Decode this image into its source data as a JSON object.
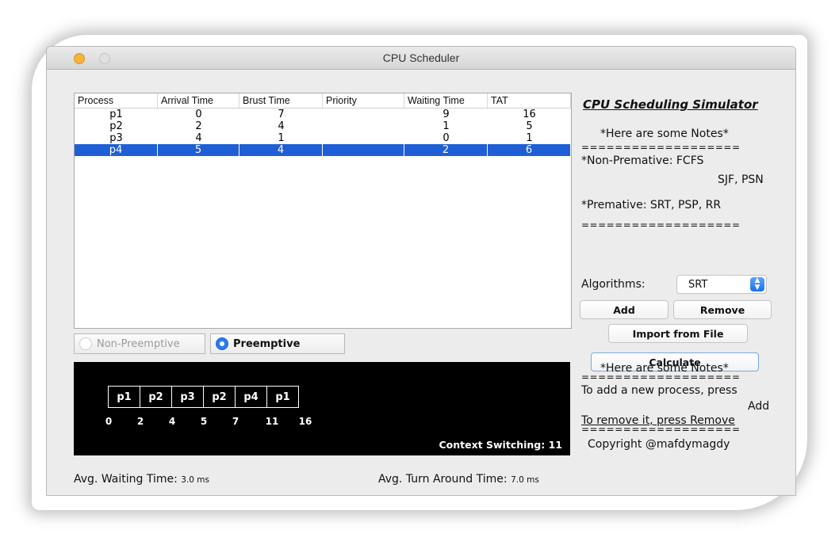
{
  "window": {
    "title": "CPU Scheduler"
  },
  "table": {
    "headers": [
      "Process",
      "Arrival Time",
      "Brust Time",
      "Priority",
      "Waiting Time",
      "TAT"
    ],
    "rows": [
      [
        "p1",
        "0",
        "7",
        "",
        "9",
        "16"
      ],
      [
        "p2",
        "2",
        "4",
        "",
        "1",
        "5"
      ],
      [
        "p3",
        "4",
        "1",
        "",
        "0",
        "1"
      ],
      [
        "p4",
        "5",
        "4",
        "",
        "2",
        "6"
      ]
    ],
    "selected_row": 3
  },
  "mode": {
    "non_preemptive_label": "Non-Preemptive",
    "preemptive_label": "Preemptive",
    "selected": "Preemptive"
  },
  "gantt": {
    "blocks": [
      "p1",
      "p2",
      "p3",
      "p2",
      "p4",
      "p1"
    ],
    "times": [
      "0",
      "2",
      "4",
      "5",
      "7",
      "11",
      "16"
    ],
    "context_switching": "Context Switching: 11"
  },
  "footer": {
    "avg_waiting_label": "Avg. Waiting Time:",
    "avg_waiting_value": "3.0 ms",
    "avg_tat_label": "Avg. Turn Around Time:",
    "avg_tat_value": "7.0 ms"
  },
  "panel": {
    "title": "CPU Scheduling Simulator",
    "notes_heading": "*Here are some Notes*",
    "separator": "===================",
    "non_premative_line1": "*Non-Premative: FCFS",
    "non_premative_line2": "SJF, PSN",
    "premative_line": "*Premative: SRT, PSP, RR",
    "algorithms_label": "Algorithms:",
    "algorithm_selected": "SRT",
    "add_label": "Add",
    "remove_label": "Remove",
    "import_label": "Import from File",
    "calculate_label": "Calculate",
    "notes2_heading": "*Here are some Notes*",
    "note_add_line1": "To add a new process, press",
    "note_add_line2": "Add",
    "note_remove": "To remove it, press Remove",
    "copyright": "Copyright @mafdymagdy"
  },
  "colors": {
    "selection": "#1f5fd6",
    "radio_selected": "#2a7bf0",
    "gantt_background": "#000000"
  }
}
